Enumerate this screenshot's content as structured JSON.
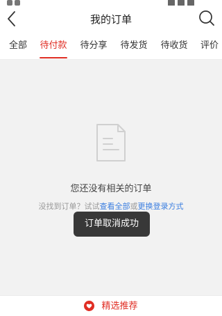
{
  "nav": {
    "title": "我的订单"
  },
  "tabs": [
    {
      "label": "全部"
    },
    {
      "label": "待付款",
      "active": true
    },
    {
      "label": "待分享"
    },
    {
      "label": "待发货"
    },
    {
      "label": "待收货"
    },
    {
      "label": "评价"
    }
  ],
  "empty": {
    "title": "您还没有相关的订单",
    "hint_prefix": "没找到订单？试试",
    "link_all": "查看全部",
    "hint_or": "或",
    "link_switch": "更换登录方式"
  },
  "toast": {
    "text": "订单取消成功"
  },
  "bottom": {
    "recommend_label": "精选推荐"
  },
  "colors": {
    "accent": "#e02e24",
    "link": "#3b7ee0"
  },
  "icons": {
    "back": "chevron-left-icon",
    "search": "search-icon",
    "empty": "document-icon",
    "recommend": "heart-icon"
  }
}
